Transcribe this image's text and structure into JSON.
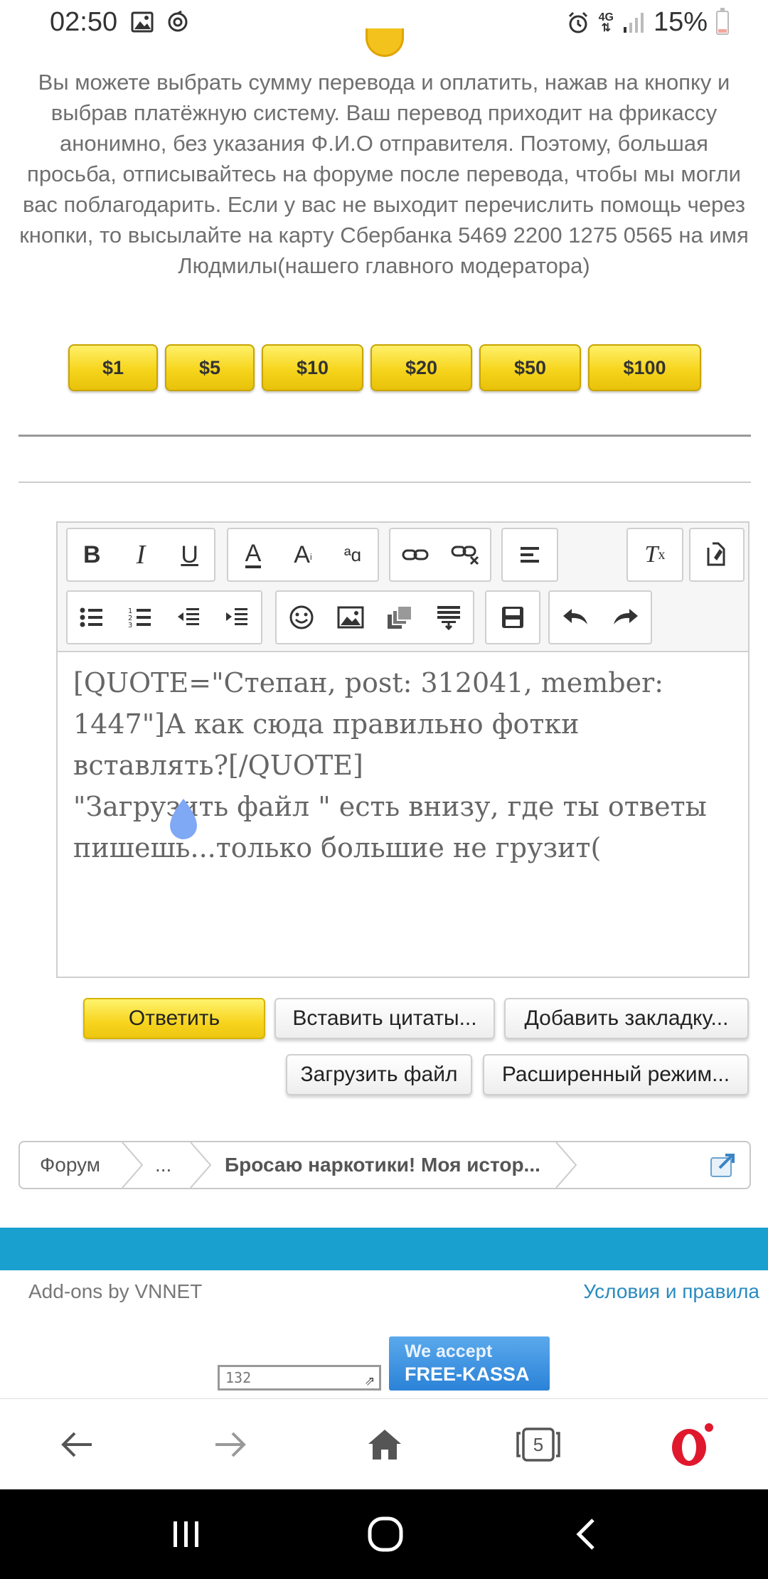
{
  "status_bar": {
    "time": "02:50",
    "battery": "15%",
    "network": "4G",
    "icons": [
      "image-icon",
      "sync-icon",
      "alarm-icon",
      "data-arrows-icon",
      "signal-icon",
      "battery-icon"
    ]
  },
  "intro_text": "Вы можете выбрать сумму перевода и оплатить, нажав на кнопку и выбрав платёжную систему. Ваш перевод приходит на фрикассу анонимно, без указания Ф.И.О отправителя. Поэтому, большая просьба, отписывайтесь на форуме после перевода, чтобы мы могли вас поблагодарить. Если у вас не выходит перечислить помощь через кнопки, то высылайте на карту Сбербанка 5469 2200 1275 0565 на имя Людмилы(нашего главного модератора)",
  "donate_buttons": [
    "$1",
    "$5",
    "$10",
    "$20",
    "$50",
    "$100"
  ],
  "editor": {
    "toolbar_row1": [
      "bold-icon",
      "italic-icon",
      "underline-icon",
      "font-color-icon",
      "font-size-icon",
      "font-family-icon",
      "link-icon",
      "unlink-icon",
      "align-icon",
      "remove-format-icon",
      "toggle-bbcode-icon"
    ],
    "toolbar_row2": [
      "bullet-list-icon",
      "numbered-list-icon",
      "outdent-icon",
      "indent-icon",
      "smilie-icon",
      "image-icon",
      "media-icon",
      "insert-icon",
      "save-draft-icon",
      "undo-icon",
      "redo-icon"
    ],
    "text": "[QUOTE=\"Степан, post: 312041, member: 1447\"]А как сюда правильно фотки вставлять?[/QUOTE]\n\"Загрузить файл \" есть внизу, где ты ответы пишешь...только большие не грузит("
  },
  "actions": {
    "reply": "Ответить",
    "insert_quotes": "Вставить цитаты...",
    "add_bookmark": "Добавить закладку...",
    "upload_file": "Загрузить файл",
    "advanced_mode": "Расширенный режим..."
  },
  "breadcrumb": {
    "items": [
      "Форум",
      "...",
      "Бросаю наркотики! Моя истор..."
    ]
  },
  "footer": {
    "addons": "Add-ons by VNNET",
    "terms": "Условия и правила",
    "counter": "132",
    "badge_line1": "We accept",
    "badge_line2": "FREE-KASSA"
  },
  "browser_bar": {
    "tab_count": "5"
  },
  "colors": {
    "accent_blue": "#1aa0ce",
    "button_yellow": "#f6d51c",
    "link_blue": "#2a8bc0",
    "opera_red": "#e0182d"
  }
}
